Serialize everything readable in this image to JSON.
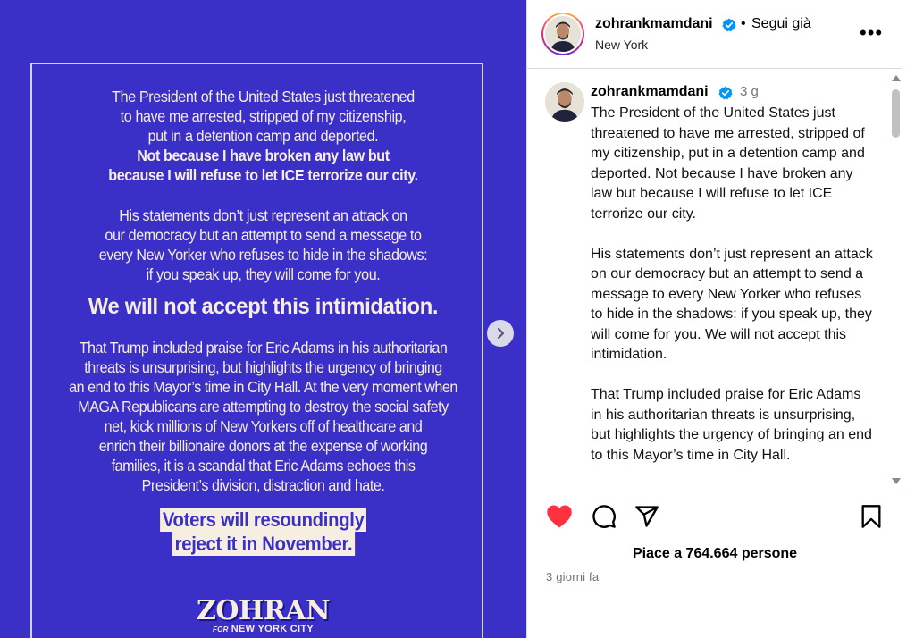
{
  "poster": {
    "para1_normal": "The President of the United States just threatened\nto have me arrested, stripped of my citizenship,\nput in a detention camp and deported.",
    "para1_bold": "Not because I have broken any law but\nbecause I will refuse to let ICE terrorize our city.",
    "para2": "His statements don’t just represent an attack on\nour democracy but an attempt to send a message to\nevery New Yorker who refuses to hide in the shadows:\nif you speak up, they will come for you.",
    "para3": "We will not accept this intimidation.",
    "para4": "That Trump included praise for Eric Adams in his authoritarian\nthreats is unsurprising, but highlights the urgency of bringing\nan end to this Mayor’s time in City Hall. At the very moment when\nMAGA Republicans are attempting to destroy the social safety\nnet, kick millions of New Yorkers off of healthcare and\nenrich their billionaire donors at the expense of working\nfamilies, it is a scandal that Eric Adams echoes this\nPresident’s division, distraction and hate.",
    "para5_line1": "Voters will resoundingly",
    "para5_line2": "reject it in November.",
    "logo_name": "ZOHRAN",
    "logo_for": "FOR",
    "logo_city": "NEW YORK CITY",
    "background_color": "#3a2fc7",
    "text_color": "#f6eee0"
  },
  "carousel": {
    "next_icon": "chevron-right-icon"
  },
  "header": {
    "username": "zohrankmamdani",
    "separator": "•",
    "follow_status": "Segui già",
    "location": "New York",
    "more_icon": "more-horizontal-icon",
    "more_glyph": "•••"
  },
  "caption": {
    "username": "zohrankmamdani",
    "time": "3 g",
    "paragraphs": [
      "The President of the United States just threatened to have me arrested, stripped of my citizenship, put in a detention camp and deported. Not because I have broken any law but because I will refuse to let ICE terrorize our city.",
      "His statements don’t just represent an attack on our democracy but an attempt to send a message to every New Yorker who refuses to hide in the shadows: if you speak up, they will come for you. We will not accept this intimidation.",
      "That Trump included praise for Eric Adams in his authoritarian threats is unsurprising, but highlights the urgency of bringing an end to this Mayor’s time in City Hall."
    ]
  },
  "actions": {
    "like_icon": "heart-filled-icon",
    "comment_icon": "comment-icon",
    "share_icon": "send-icon",
    "save_icon": "bookmark-icon",
    "like_color": "#ff3040"
  },
  "likes_text": "Piace a 764.664 persone",
  "posted_ago": "3 giorni fa",
  "verified_color": "#0095f6"
}
